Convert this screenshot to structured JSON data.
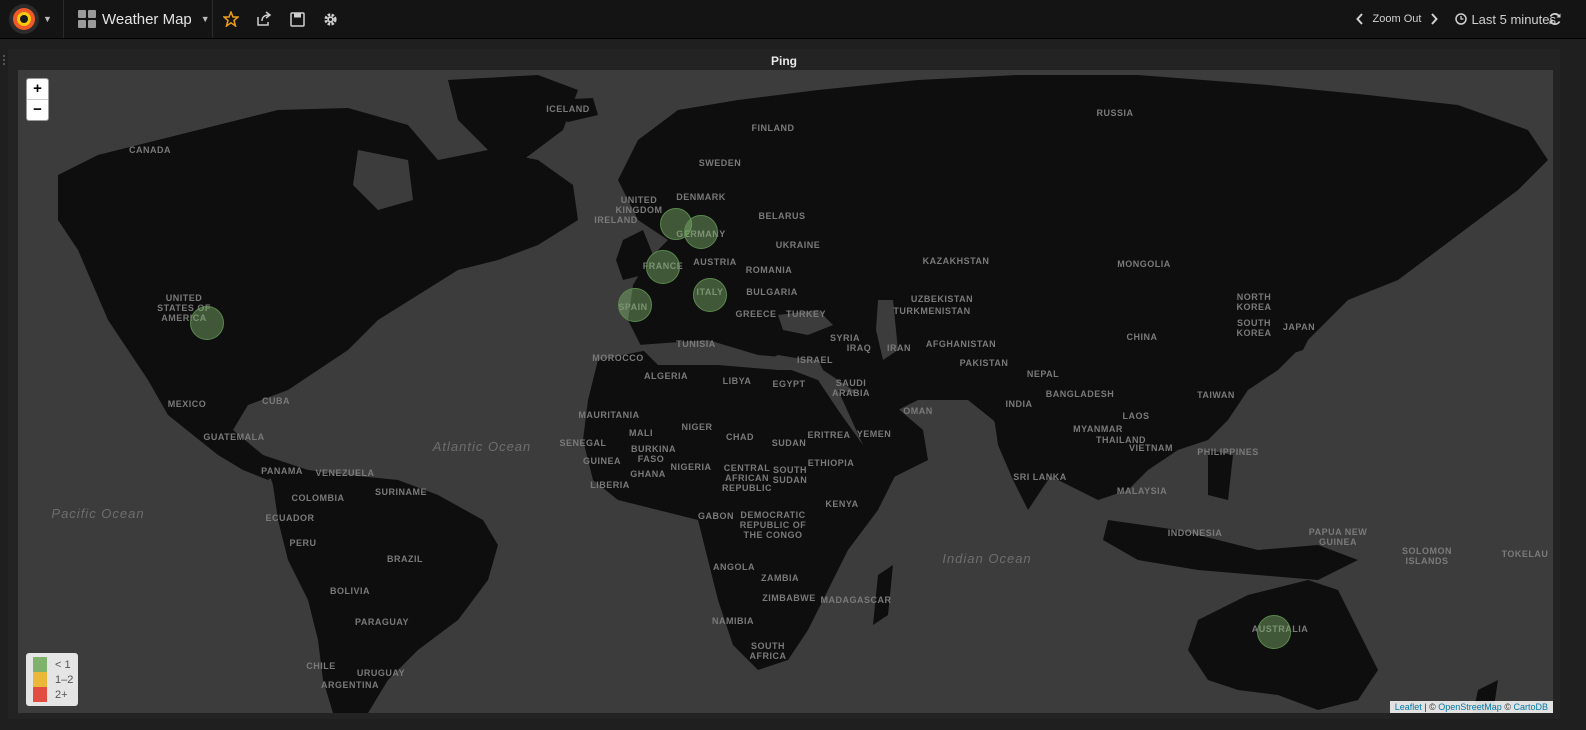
{
  "navbar": {
    "dashboard_title": "Weather Map",
    "zoom_out_label": "Zoom Out",
    "time_range_label": "Last 5 minutes"
  },
  "panel": {
    "title": "Ping"
  },
  "map": {
    "zoom_in_label": "+",
    "zoom_out_label": "−",
    "attribution": {
      "leaflet": "Leaflet",
      "sep": "| ©",
      "osm": "OpenStreetMap",
      "copy": "©",
      "carto": "CartoDB"
    },
    "legend": [
      {
        "label": "< 1",
        "color": "#7eb26d"
      },
      {
        "label": "1–2",
        "color": "#eab839"
      },
      {
        "label": "2+",
        "color": "#e24d42"
      }
    ],
    "markers": [
      {
        "name": "United States",
        "value_bucket": "< 1",
        "color": "#7eb26d"
      },
      {
        "name": "United Kingdom",
        "value_bucket": "< 1",
        "color": "#7eb26d"
      },
      {
        "name": "Germany",
        "value_bucket": "< 1",
        "color": "#7eb26d"
      },
      {
        "name": "France",
        "value_bucket": "< 1",
        "color": "#7eb26d"
      },
      {
        "name": "Spain",
        "value_bucket": "< 1",
        "color": "#7eb26d"
      },
      {
        "name": "Italy",
        "value_bucket": "< 1",
        "color": "#7eb26d"
      },
      {
        "name": "Australia",
        "value_bucket": "< 1",
        "color": "#7eb26d"
      }
    ],
    "country_labels": [
      "Iceland",
      "Russia",
      "Finland",
      "Canada",
      "Sweden",
      "Denmark",
      "United Kingdom",
      "Ireland",
      "Belarus",
      "Germany",
      "Ukraine",
      "France",
      "Austria",
      "Romania",
      "Kazakhstan",
      "Mongolia",
      "United States of America",
      "Spain",
      "Italy",
      "Bulgaria",
      "Uzbekistan",
      "Turkmenistan",
      "Turkey",
      "North Korea",
      "South Korea",
      "Japan",
      "Greece",
      "Syria",
      "China",
      "Tunisia",
      "Iraq",
      "Iran",
      "Afghanistan",
      "Morocco",
      "Israel",
      "Pakistan",
      "Nepal",
      "Algeria",
      "Libya",
      "Egypt",
      "Saudi Arabia",
      "Bangladesh",
      "Mexico",
      "Cuba",
      "Oman",
      "India",
      "Taiwan",
      "Laos",
      "Mauritania",
      "Myanmar",
      "Mali",
      "Niger",
      "Chad",
      "Sudan",
      "Eritrea",
      "Yemen",
      "Thailand",
      "Guatemala",
      "Senegal",
      "Vietnam",
      "Philippines",
      "Burkina Faso",
      "Guinea",
      "Ghana",
      "Nigeria",
      "Ethiopia",
      "Central African Republic",
      "South Sudan",
      "Panama",
      "Venezuela",
      "Suriname",
      "Liberia",
      "Sri Lanka",
      "Malaysia",
      "Colombia",
      "Kenya",
      "Gabon",
      "Democratic Republic of the Congo",
      "Ecuador",
      "Indonesia",
      "Papua New Guinea",
      "Solomon Islands",
      "Tokelau",
      "Peru",
      "Brazil",
      "Angola",
      "Zambia",
      "Zimbabwe",
      "Madagascar",
      "Bolivia",
      "Namibia",
      "Paraguay",
      "South Africa",
      "Australia",
      "Chile",
      "Uruguay",
      "Argentina"
    ],
    "oceans": [
      "Atlantic Ocean",
      "Pacific Ocean",
      "Indian Ocean"
    ]
  }
}
